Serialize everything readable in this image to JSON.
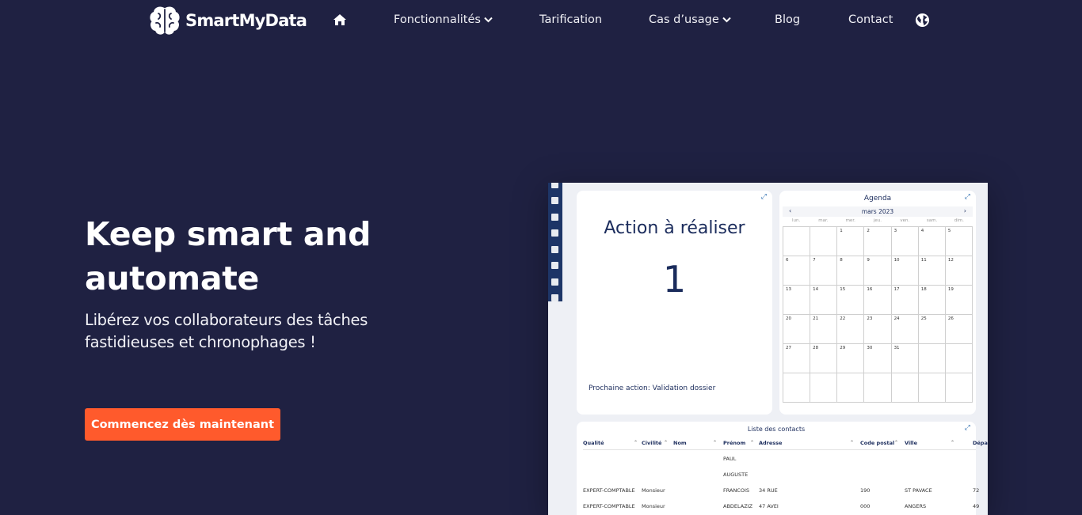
{
  "nav": {
    "brand": "SmartMyData",
    "links": [
      {
        "label": "Fonctionnalités",
        "dropdown": true
      },
      {
        "label": "Tarification",
        "dropdown": false
      },
      {
        "label": "Cas d’usage",
        "dropdown": true
      },
      {
        "label": "Blog",
        "dropdown": false
      },
      {
        "label": "Contact",
        "dropdown": false
      }
    ],
    "icons": [
      "home-icon",
      "globe-icon",
      "brain-logo-icon",
      "chevron-down-icon"
    ]
  },
  "hero": {
    "title": "Keep smart and automate",
    "subtitle": "Libérez vos collaborateurs des tâches fastidieuses et chronophages !",
    "cta": "Commencez dès maintenant"
  },
  "colors": {
    "background": "#1f2142",
    "cta": "#ff5a2c",
    "dashboard_text": "#1b2c5c",
    "rail": "#1d3567"
  },
  "dashboard": {
    "action": {
      "title": "Action à réaliser",
      "count": "1",
      "next": "Prochaine action: Validation dossier"
    },
    "agenda": {
      "title": "Agenda",
      "month": "mars 2023",
      "prev": "‹",
      "next": "›",
      "weekdays": [
        "lun.",
        "mar.",
        "mer.",
        "jeu.",
        "ven.",
        "sam.",
        "dim."
      ],
      "cells": [
        "",
        "",
        "1",
        "2",
        "3",
        "4",
        "5",
        "6",
        "7",
        "8",
        "9",
        "10",
        "11",
        "12",
        "13",
        "14",
        "15",
        "16",
        "17",
        "18",
        "19",
        "20",
        "21",
        "22",
        "23",
        "24",
        "25",
        "26",
        "27",
        "28",
        "29",
        "30",
        "31",
        "",
        "",
        "",
        "",
        "",
        "",
        "",
        "",
        ""
      ]
    },
    "contacts": {
      "title": "Liste des contacts",
      "headers": [
        "Qualité",
        "Civilité",
        "Nom",
        "Prénom",
        "Adresse",
        "Code postal",
        "Ville",
        "Dépa"
      ],
      "rows": [
        [
          "",
          "",
          "",
          "PAUL",
          "",
          "",
          "",
          ""
        ],
        [
          "",
          "",
          "",
          "AUGUSTE",
          "",
          "",
          "",
          ""
        ],
        [
          "EXPERT-COMPTABLE",
          "Monsieur",
          "",
          "FRANCOIS",
          "34 RUE",
          "190",
          "ST PAVACE",
          "72"
        ],
        [
          "EXPERT-COMPTABLE",
          "Monsieur",
          "",
          "ABDELAZIZ",
          "47 AVEI",
          "000",
          "ANGERS",
          "49"
        ]
      ]
    }
  }
}
